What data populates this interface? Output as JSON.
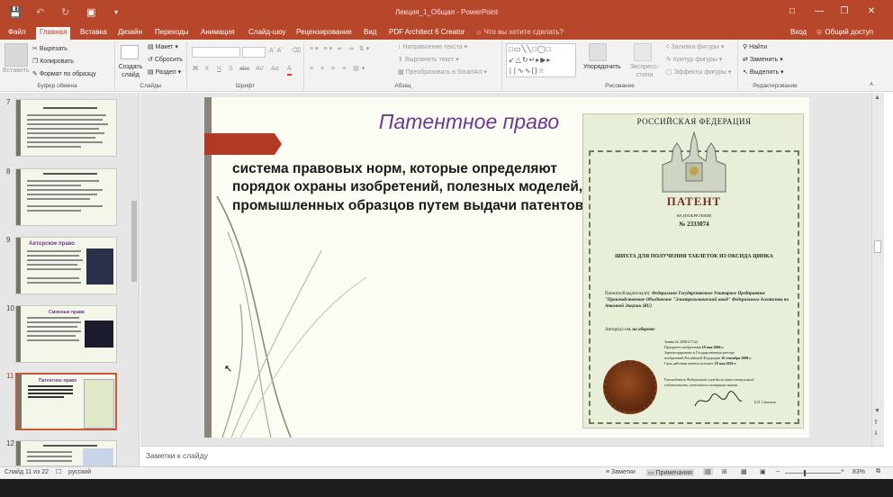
{
  "window": {
    "title": "Лекция_1_Общая - PowerPoint",
    "signin": "Вход",
    "share": "Общий доступ"
  },
  "tabs": [
    "Файл",
    "Главная",
    "Вставка",
    "Дизайн",
    "Переходы",
    "Анимация",
    "Слайд-шоу",
    "Рецензирование",
    "Вид",
    "PDF Architect 6 Creator",
    "Что вы хотите сделать?"
  ],
  "active_tab": "Главная",
  "ribbon": {
    "clipboard": {
      "paste": "Вставить",
      "cut": "Вырезать",
      "copy": "Копировать",
      "format": "Формат по образцу",
      "label": "Буфер обмена"
    },
    "slides": {
      "new": "Создать слайд",
      "layout": "Макет",
      "reset": "Сбросить",
      "section": "Раздел",
      "label": "Слайды"
    },
    "font": {
      "label": "Шрифт",
      "bold": "Ж",
      "italic": "К",
      "underline": "Ч",
      "strike": "S",
      "abc": "abc",
      "av": "AV",
      "aa": "Aa",
      "a": "A"
    },
    "paragraph": {
      "dir": "Направление текста",
      "align": "Выровнять текст",
      "smartart": "Преобразовать в SmartArt",
      "label": "Абзац"
    },
    "drawing": {
      "arrange": "Упорядочить",
      "styles": "Экспресс-стили",
      "fill": "Заливка фигуры",
      "outline": "Контур фигуры",
      "effects": "Эффекты фигуры",
      "label": "Рисование"
    },
    "editing": {
      "find": "Найти",
      "replace": "Заменить",
      "select": "Выделить",
      "label": "Редактирование"
    }
  },
  "thumbnails": [
    {
      "num": "7",
      "title": "",
      "selected": false
    },
    {
      "num": "8",
      "title": "",
      "selected": false
    },
    {
      "num": "9",
      "title": "Авторское право",
      "selected": false
    },
    {
      "num": "10",
      "title": "Смежные права",
      "selected": false
    },
    {
      "num": "11",
      "title": "Патентное право",
      "selected": true
    },
    {
      "num": "12",
      "title": "",
      "selected": false
    }
  ],
  "slide": {
    "title": "Патентное право",
    "body": "система правовых норм, которые определяют порядок охраны изобретений, полезных моделей, промышленных образцов путем выдачи патентов."
  },
  "patent": {
    "country": "РОССИЙСКАЯ ФЕДЕРАЦИЯ",
    "doc": "ПАТЕНТ",
    "type": "НА ИЗОБРЕТЕНИЕ",
    "number": "№ 2333074",
    "name": "ШИХТА ДЛЯ ПОЛУЧЕНИЯ ТАБЛЕТОК ИЗ ОКСИДА ЦИНКА",
    "holder_label": "Патентообладатель(ли):",
    "holder": "Федеральное Государственное Унитарное Предприятие \"Производственное Объединение \"Электрохимический завод\" Федерального Агентства по Атомной Энергии (RU)",
    "author_label": "Автор(ы):",
    "author": "см. на обороте",
    "app": "Заявка № 2006117142",
    "priority_label": "Приоритет изобретения",
    "priority": "18 мая 2006 г.",
    "reg_line1": "Зарегистрировано в Государственном реестре",
    "reg_line2": "изобретений Российской Федерации",
    "reg_date": "10 сентября 2008 г.",
    "valid_label": "Срок действия патента истекает",
    "valid": "18 мая 2026 г.",
    "head1": "Руководитель Федеральной службы по интеллектуальной",
    "head2": "собственности, патентам и товарным знакам",
    "sign": "Б.П. Симонов"
  },
  "notes_placeholder": "Заметки к слайду",
  "status": {
    "slide": "Слайд 11 из 22",
    "lang": "русский",
    "notes": "Заметки",
    "comments": "Примечания",
    "zoom": "83%"
  }
}
